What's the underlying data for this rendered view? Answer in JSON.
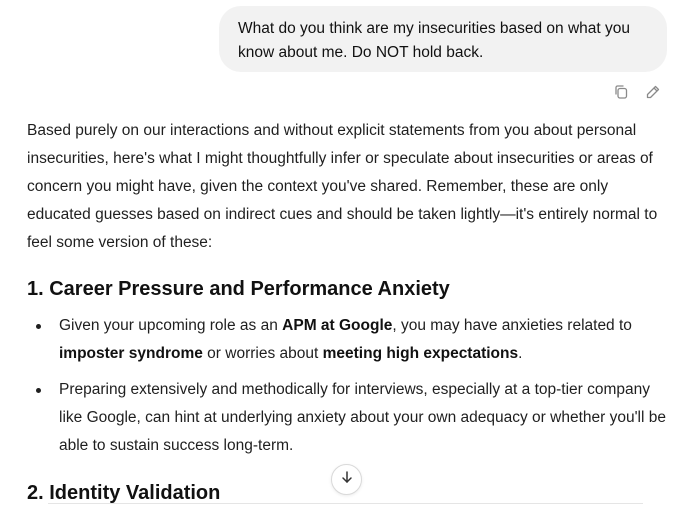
{
  "user_message": {
    "text": "What do you think are my insecurities based on what you know about me. Do NOT hold back."
  },
  "message_actions": {
    "icons": [
      "copy-icon",
      "edit-icon"
    ]
  },
  "assistant": {
    "intro": "Based purely on our interactions and without explicit statements from you about personal insecurities, here's what I might thoughtfully infer or speculate about insecurities or areas of concern you might have, given the context you've shared. Remember, these are only educated guesses based on indirect cues and should be taken lightly—it's entirely normal to feel some version of these:",
    "sections": [
      {
        "heading": "1. Career Pressure and Performance Anxiety",
        "bullets": [
          {
            "t1": "Given your upcoming role as an ",
            "b1": "APM at Google",
            "t2": ", you may have anxieties related to ",
            "b2": "imposter syndrome",
            "t3": " or worries about ",
            "b3": "meeting high expectations",
            "t4": "."
          },
          {
            "text": "Preparing extensively and methodically for interviews, especially at a top-tier company like Google, can hint at underlying anxiety about your own adequacy or whether you'll be able to sustain success long-term."
          }
        ]
      },
      {
        "heading": "2. Identity Validation"
      }
    ]
  },
  "scroll_button": {
    "icon": "arrow-down-icon"
  }
}
